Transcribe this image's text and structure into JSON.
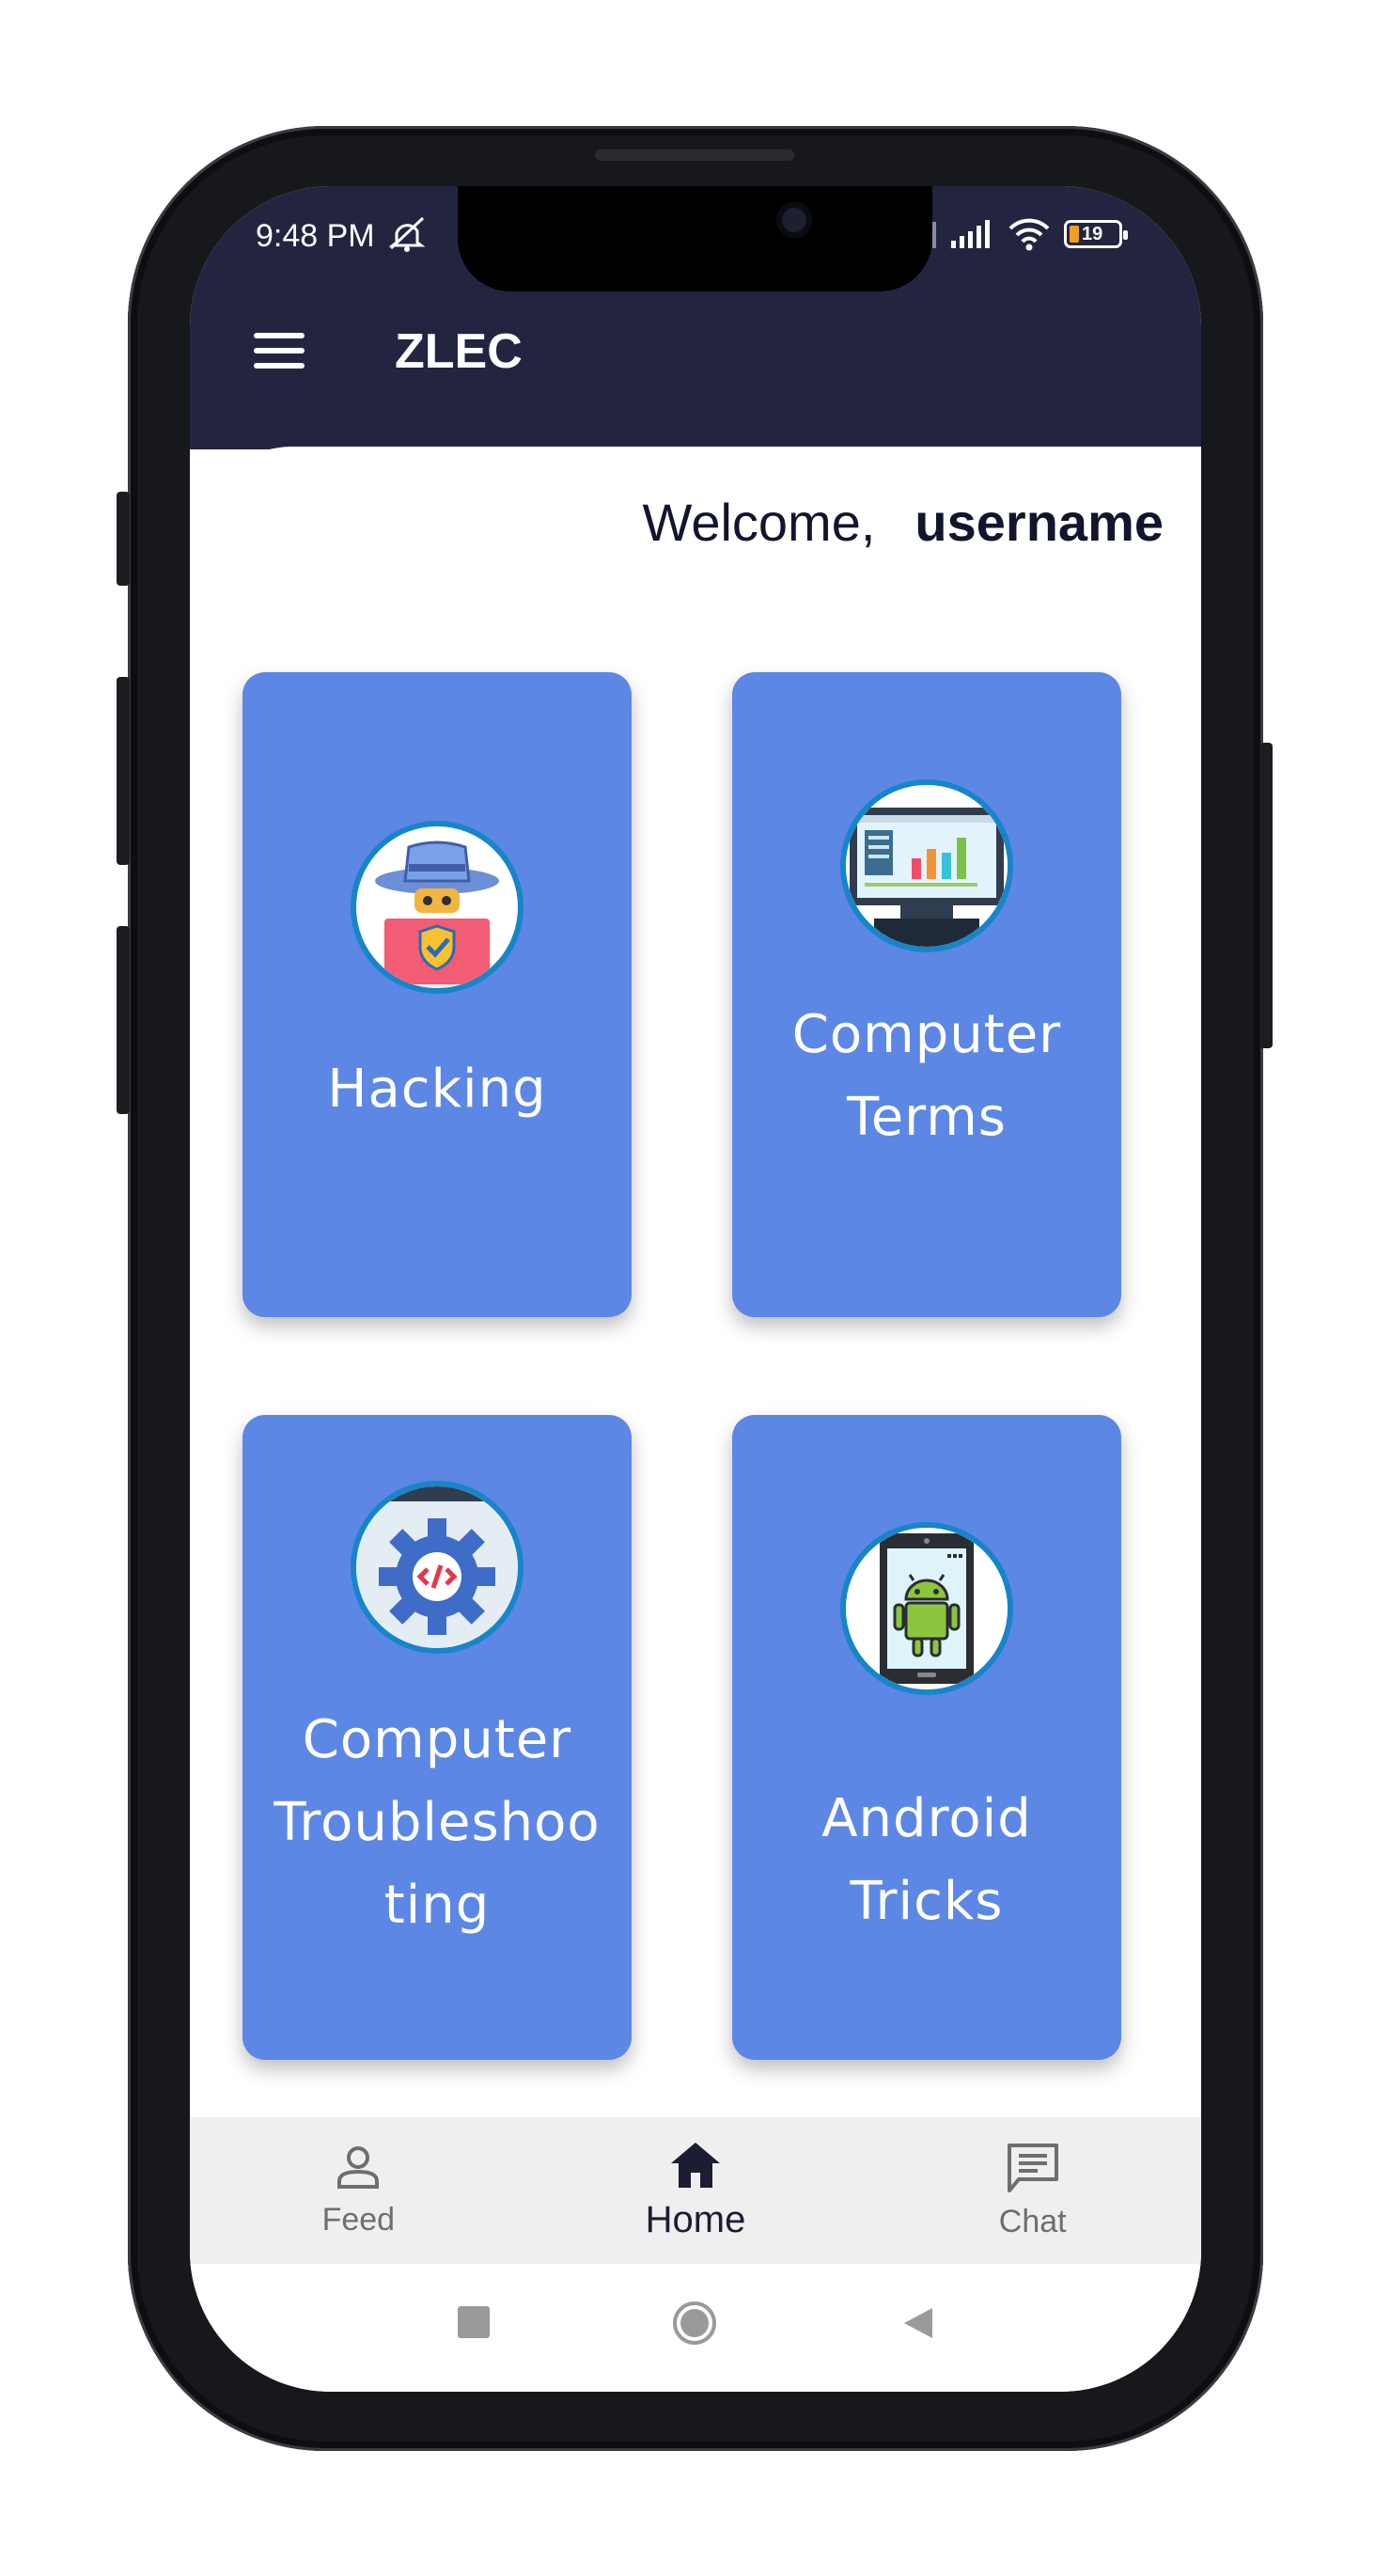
{
  "status_bar": {
    "time": "9:48 PM",
    "battery": "19"
  },
  "app_bar": {
    "title": "ZLEC"
  },
  "welcome": {
    "greeting": "Welcome,",
    "username": "username"
  },
  "cards": [
    {
      "label": "Hacking",
      "icon": "hacker-icon"
    },
    {
      "label": "Computer Terms",
      "icon": "dashboard-monitor-icon"
    },
    {
      "label": "Computer Troubleshooting",
      "icon": "gear-code-icon"
    },
    {
      "label": "Android Tricks",
      "icon": "android-phone-icon"
    }
  ],
  "card_lines": {
    "c0": [
      "Hacking"
    ],
    "c1": [
      "Computer",
      "Terms"
    ],
    "c2": [
      "Computer",
      "Troubleshoo",
      "ting"
    ],
    "c3": [
      "Android",
      "Tricks"
    ]
  },
  "bottom_nav": {
    "items": [
      {
        "label": "Feed",
        "icon": "person-icon"
      },
      {
        "label": "Home",
        "icon": "home-icon",
        "active": true
      },
      {
        "label": "Chat",
        "icon": "chat-icon"
      }
    ]
  },
  "system_nav": [
    "recents-button",
    "home-button",
    "back-button"
  ],
  "colors": {
    "header": "#232440",
    "card": "#5d87e4",
    "nav_bg": "#efefef"
  }
}
